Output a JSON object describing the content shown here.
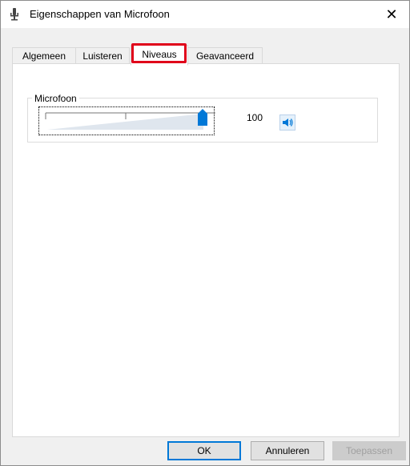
{
  "window": {
    "title": "Eigenschappen van Microfoon",
    "close_glyph": "✕"
  },
  "tabs": [
    {
      "label": "Algemeen",
      "active": false
    },
    {
      "label": "Luisteren",
      "active": false
    },
    {
      "label": "Niveaus",
      "active": true
    },
    {
      "label": "Geavanceerd",
      "active": false
    }
  ],
  "levels": {
    "group_label": "Microfoon",
    "level_value": "100",
    "level_fraction": 1.0
  },
  "buttons": {
    "ok": "OK",
    "cancel": "Annuleren",
    "apply": "Toepassen"
  },
  "colors": {
    "highlight": "#e0001a",
    "accent": "#0078d7",
    "slider_fill": "#dfe6ee"
  },
  "icons": {
    "title": "microphone-icon",
    "close": "close-icon",
    "speaker": "speaker-icon"
  }
}
